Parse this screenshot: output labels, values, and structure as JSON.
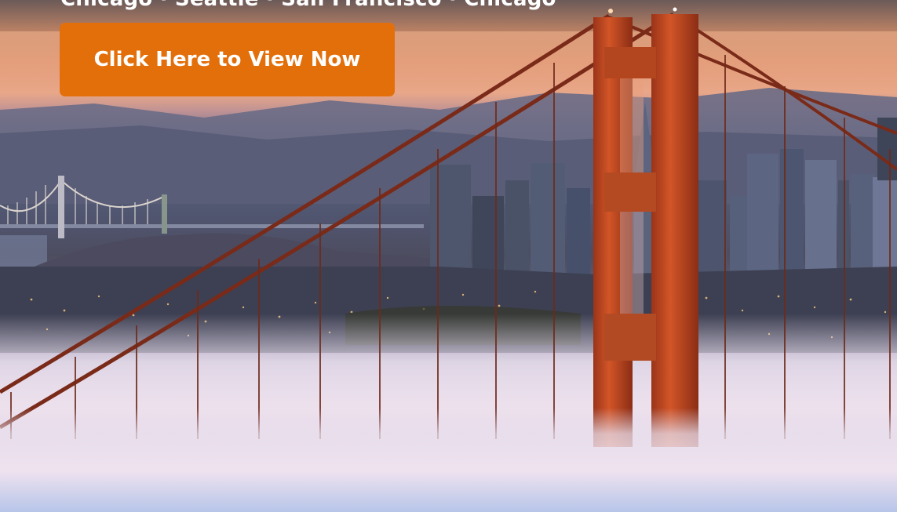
{
  "hero": {
    "headline": "Chicago · Seattle · San Francisco · Chicago",
    "image_subject": "golden-gate-bridge-fog-city"
  },
  "cta": {
    "label": "Click Here to View Now"
  },
  "colors": {
    "cta_background": "#e36f0b",
    "cta_text": "#ffffff",
    "bridge_tower": "#c0431f",
    "fog": "#eadff0"
  }
}
